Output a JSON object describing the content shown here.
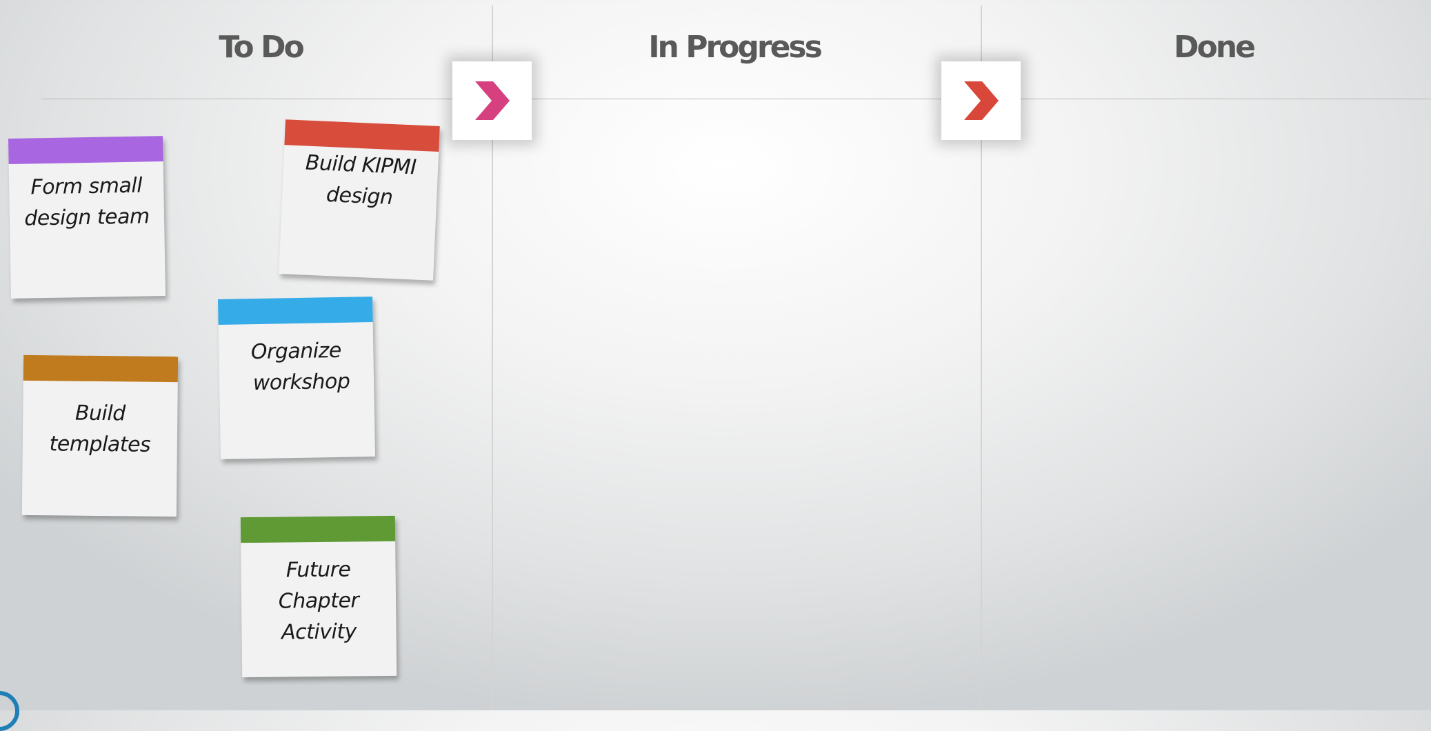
{
  "columns": [
    {
      "title": "To Do"
    },
    {
      "title": "In Progress"
    },
    {
      "title": "Done"
    }
  ],
  "transitions": [
    {
      "icon": "chevron-right-icon",
      "color": "#d6407e"
    },
    {
      "icon": "chevron-right-icon",
      "color": "#d9473a"
    }
  ],
  "cards": [
    {
      "text_line1": "Form small",
      "text_line2": "design team",
      "text_line3": "",
      "color": "#a866e0"
    },
    {
      "text_line1": "Build KIPMI",
      "text_line2": "design",
      "text_line3": "",
      "color": "#d84c3c"
    },
    {
      "text_line1": "Organize",
      "text_line2": "workshop",
      "text_line3": "",
      "color": "#35abe8"
    },
    {
      "text_line1": "Build",
      "text_line2": "templates",
      "text_line3": "",
      "color": "#c07b1f"
    },
    {
      "text_line1": "Future",
      "text_line2": "Chapter",
      "text_line3": "Activity",
      "color": "#5f9a35"
    }
  ]
}
